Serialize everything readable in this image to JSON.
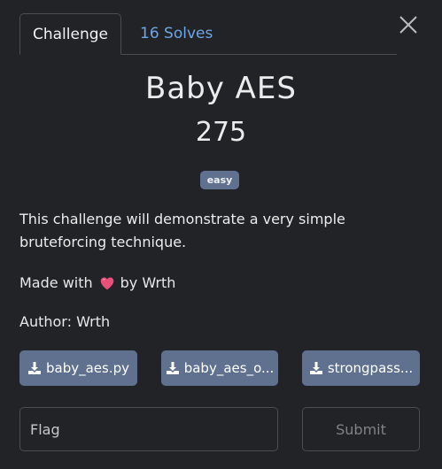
{
  "tabs": {
    "challenge": "Challenge",
    "solves": "16 Solves"
  },
  "challenge": {
    "name": "Baby AES",
    "points": "275",
    "difficulty": "easy",
    "description": "This challenge will demonstrate a very simple bruteforcing technique.",
    "made_with_prefix": "Made with",
    "made_with_suffix": "by Wrth",
    "author": "Author: Wrth"
  },
  "files": [
    {
      "label": "baby_aes.py"
    },
    {
      "label": "baby_aes_o..."
    },
    {
      "label": "strongpass..."
    }
  ],
  "flag_form": {
    "placeholder": "Flag",
    "submit_label": "Submit"
  },
  "icons": {
    "close": "close-icon",
    "heart": "heart-icon",
    "download": "download-icon"
  },
  "colors": {
    "background": "#212327",
    "badge": "#5f718e",
    "file_button": "#5f718e",
    "link": "#6ea6e8",
    "heart": "#e8507a"
  }
}
